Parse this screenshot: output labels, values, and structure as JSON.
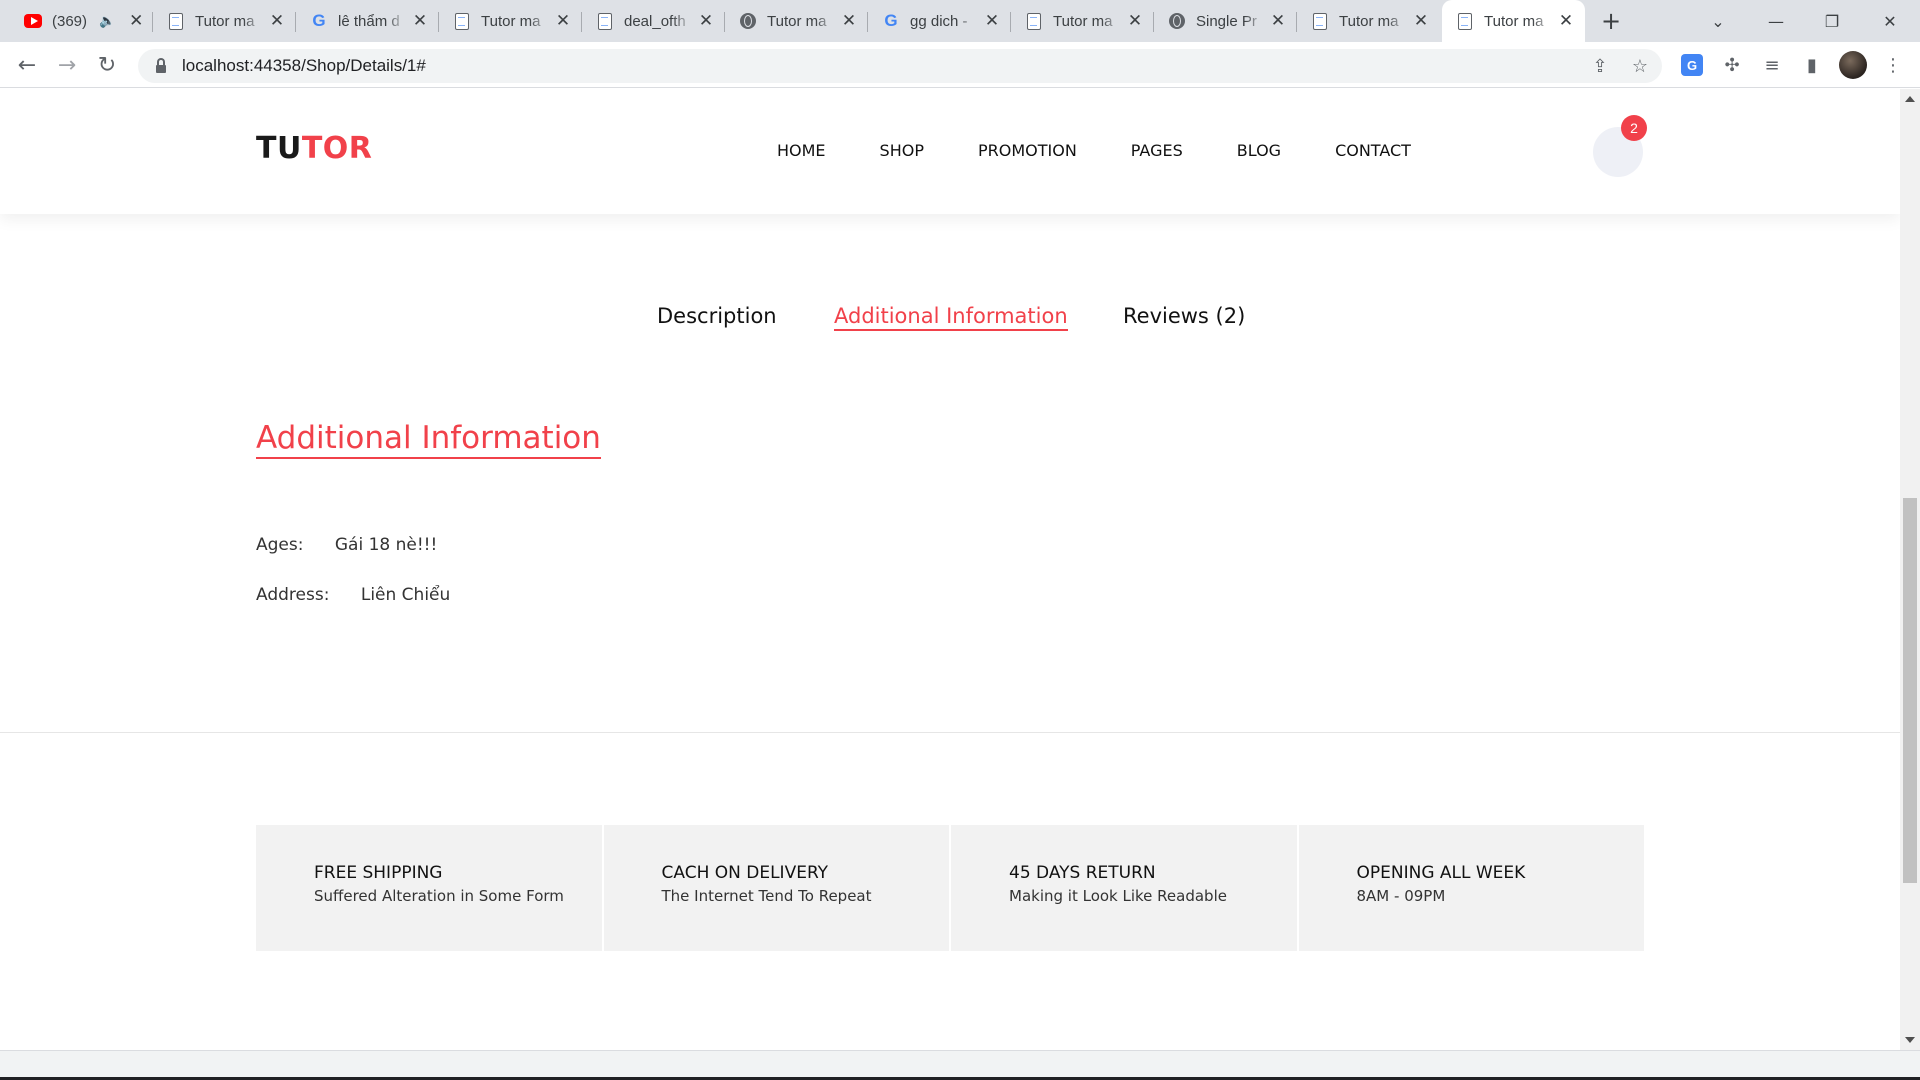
{
  "browser": {
    "tabs": [
      {
        "title": "(369)",
        "favicon": "youtube-icon",
        "muted": true
      },
      {
        "title": "Tutor ma",
        "favicon": "document-icon"
      },
      {
        "title": "lê thẩm d",
        "favicon": "google-icon"
      },
      {
        "title": "Tutor ma",
        "favicon": "document-icon"
      },
      {
        "title": "deal_ofth",
        "favicon": "document-icon"
      },
      {
        "title": "Tutor ma",
        "favicon": "globe-icon"
      },
      {
        "title": "gg dich -",
        "favicon": "google-icon"
      },
      {
        "title": "Tutor ma",
        "favicon": "document-icon"
      },
      {
        "title": "Single Pr",
        "favicon": "globe-icon"
      },
      {
        "title": "Tutor ma",
        "favicon": "document-icon"
      },
      {
        "title": "Tutor ma",
        "favicon": "document-icon",
        "active": true
      }
    ],
    "url": "localhost:44358/Shop/Details/1#"
  },
  "site": {
    "logo_part1": "TU",
    "logo_part2": "TOR",
    "menu": [
      "HOME",
      "SHOP",
      "PROMOTION",
      "PAGES",
      "BLOG",
      "CONTACT"
    ],
    "cart_count": "2"
  },
  "product_tabs": {
    "description": "Description",
    "additional": "Additional Information",
    "reviews": "Reviews (2)",
    "active": "additional"
  },
  "additional_info": {
    "title": "Additional Information",
    "rows": [
      {
        "label": "Ages:",
        "value": "Gái 18 nè!!!"
      },
      {
        "label": "Address:",
        "value": "Liên Chiểu"
      }
    ]
  },
  "features": [
    {
      "title": "FREE SHIPPING",
      "subtitle": "Suffered Alteration in Some Form"
    },
    {
      "title": "CACH ON DELIVERY",
      "subtitle": "The Internet Tend To Repeat"
    },
    {
      "title": "45 DAYS RETURN",
      "subtitle": "Making it Look Like Readable"
    },
    {
      "title": "OPENING ALL WEEK",
      "subtitle": "8AM - 09PM"
    }
  ],
  "colors": {
    "accent": "#f1414a",
    "feature_bg": "#f2f2f2",
    "tabstrip_bg": "#dee1e6"
  }
}
